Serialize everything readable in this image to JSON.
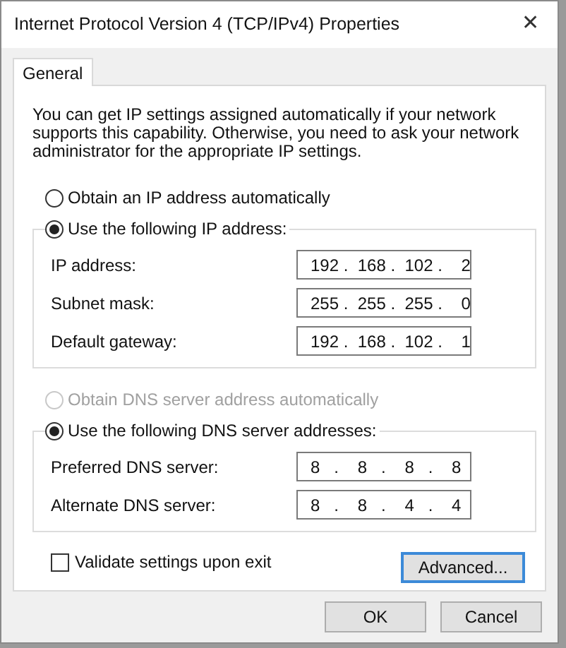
{
  "window": {
    "title": "Internet Protocol Version 4 (TCP/IPv4) Properties",
    "close": "✕"
  },
  "tabs": [
    {
      "label": "General",
      "selected": true
    }
  ],
  "intro": "You can get IP settings assigned automatically if your network supports this capability. Otherwise, you need to ask your network administrator for the appropriate IP settings.",
  "sections": [
    {
      "auto_option": {
        "label": "Obtain an IP address automatically",
        "selected": false,
        "disabled": false
      },
      "manual_option": {
        "label": "Use the following IP address:",
        "selected": true,
        "disabled": false
      },
      "fields": [
        {
          "label": "IP address:",
          "value": "192 .  168 .  102 .    2"
        },
        {
          "label": "Subnet mask:",
          "value": "255 .  255 .  255 .    0"
        },
        {
          "label": "Default gateway:",
          "value": "192 .  168 .  102 .    1"
        }
      ]
    },
    {
      "auto_option": {
        "label": "Obtain DNS server address automatically",
        "selected": false,
        "disabled": true
      },
      "manual_option": {
        "label": "Use the following DNS server addresses:",
        "selected": true,
        "disabled": false
      },
      "fields": [
        {
          "label": "Preferred DNS server:",
          "value": "8   .    8   .    8   .    8"
        },
        {
          "label": "Alternate DNS server:",
          "value": "8   .    8   .    4   .    4"
        }
      ]
    }
  ],
  "validate": {
    "label": "Validate settings upon exit",
    "checked": false
  },
  "advanced_button": "Advanced...",
  "buttons": [
    "OK",
    "Cancel"
  ]
}
